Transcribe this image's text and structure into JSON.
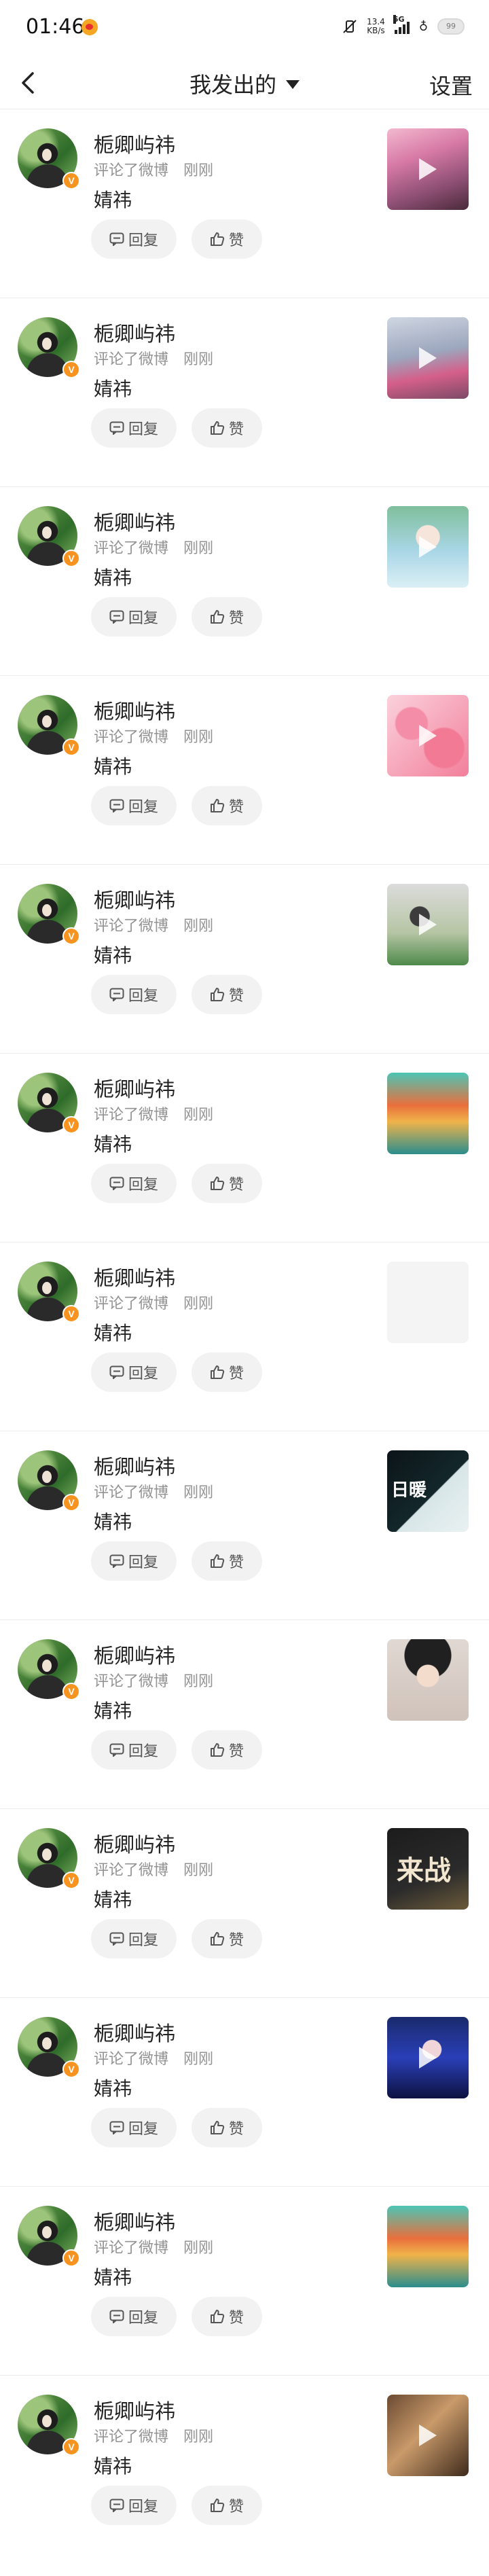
{
  "status_bar": {
    "time": "01:46",
    "net_speed_value": "13.4",
    "net_speed_unit": "KB/s",
    "network": "5G",
    "battery": "99"
  },
  "nav": {
    "title": "我发出的",
    "settings_label": "设置"
  },
  "items": [
    {
      "user": "栀卿屿祎",
      "action": "评论了微博",
      "time": "刚刚",
      "text": "婧祎",
      "reply": "回复",
      "like": "赞",
      "video": true
    },
    {
      "user": "栀卿屿祎",
      "action": "评论了微博",
      "time": "刚刚",
      "text": "婧祎",
      "reply": "回复",
      "like": "赞",
      "video": true
    },
    {
      "user": "栀卿屿祎",
      "action": "评论了微博",
      "time": "刚刚",
      "text": "婧祎",
      "reply": "回复",
      "like": "赞",
      "video": true
    },
    {
      "user": "栀卿屿祎",
      "action": "评论了微博",
      "time": "刚刚",
      "text": "婧祎",
      "reply": "回复",
      "like": "赞",
      "video": true
    },
    {
      "user": "栀卿屿祎",
      "action": "评论了微博",
      "time": "刚刚",
      "text": "婧祎",
      "reply": "回复",
      "like": "赞",
      "video": true
    },
    {
      "user": "栀卿屿祎",
      "action": "评论了微博",
      "time": "刚刚",
      "text": "婧祎",
      "reply": "回复",
      "like": "赞",
      "video": false
    },
    {
      "user": "栀卿屿祎",
      "action": "评论了微博",
      "time": "刚刚",
      "text": "婧祎",
      "reply": "回复",
      "like": "赞",
      "video": false
    },
    {
      "user": "栀卿屿祎",
      "action": "评论了微博",
      "time": "刚刚",
      "text": "婧祎",
      "reply": "回复",
      "like": "赞",
      "video": false,
      "thumb_text": "日暖"
    },
    {
      "user": "栀卿屿祎",
      "action": "评论了微博",
      "time": "刚刚",
      "text": "婧祎",
      "reply": "回复",
      "like": "赞",
      "video": false
    },
    {
      "user": "栀卿屿祎",
      "action": "评论了微博",
      "time": "刚刚",
      "text": "婧祎",
      "reply": "回复",
      "like": "赞",
      "video": false,
      "thumb_text": "来战"
    },
    {
      "user": "栀卿屿祎",
      "action": "评论了微博",
      "time": "刚刚",
      "text": "婧祎",
      "reply": "回复",
      "like": "赞",
      "video": true
    },
    {
      "user": "栀卿屿祎",
      "action": "评论了微博",
      "time": "刚刚",
      "text": "婧祎",
      "reply": "回复",
      "like": "赞",
      "video": false
    },
    {
      "user": "栀卿屿祎",
      "action": "评论了微博",
      "time": "刚刚",
      "text": "婧祎",
      "reply": "回复",
      "like": "赞",
      "video": true
    }
  ],
  "colors": {
    "verified_badge": "#f7931e",
    "button_bg": "#f2f2f2",
    "meta_text": "#939393"
  }
}
